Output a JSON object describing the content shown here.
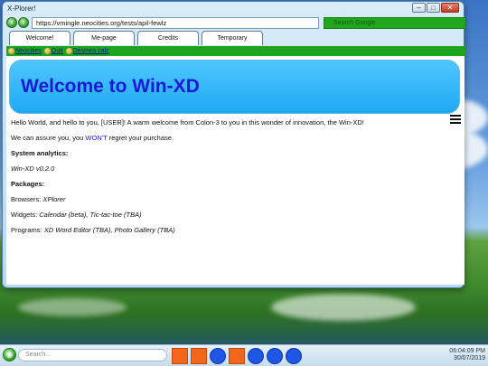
{
  "window": {
    "title": "X-Plorer!",
    "controls": {
      "minimize": "–",
      "maximize": "□",
      "close": "✕"
    }
  },
  "nav": {
    "back_icon": "back-arrow-icon",
    "forward_icon": "forward-arrow-icon",
    "url": "https://vmingle.neocities.org/tests/apil-fewlz",
    "search_placeholder": "Search Google"
  },
  "tabs": [
    {
      "label": "Welcome!"
    },
    {
      "label": "Me-page"
    },
    {
      "label": "Credits"
    },
    {
      "label": "Temporary"
    }
  ],
  "bookmarks": [
    {
      "label": "Neocities"
    },
    {
      "label": "Quit"
    },
    {
      "label": "Desmos calc"
    }
  ],
  "page": {
    "heading": "Welcome to Win-XD",
    "greeting": "Hello World, and hello to you, [USER]! A warm welcome from Colon-3 to you in this wonder of innovation, the Win-XD!",
    "assure_pre": "We can assure you, you ",
    "assure_em": "WON'T",
    "assure_post": " regret your purchase.",
    "analytics_heading": "System analytics:",
    "version": "Win-XD v0.2.0",
    "packages_heading": "Packages:",
    "browsers_label": "Browsers: ",
    "browsers_value": "XPlorer",
    "widgets_label": "Widgets: ",
    "widgets_value": "Calendar (beta), Tic-tac-toe (TBA)",
    "programs_label": "Programs: ",
    "programs_value": "XD Word Editor (TBA), Photo Gallery (TBA)"
  },
  "taskbar": {
    "search_placeholder": "Search...",
    "apps": [
      "square-app-icon",
      "square-app-icon",
      "round-app-icon",
      "square-app-icon",
      "round-app-icon",
      "round-app-icon",
      "round-app-icon"
    ],
    "time": "06:04:09 PM",
    "date": "30/07/2019"
  },
  "colors": {
    "accent_green": "#22a61f",
    "hero_blue": "#1ea9f3",
    "heading_blue": "#1a1ad6"
  }
}
